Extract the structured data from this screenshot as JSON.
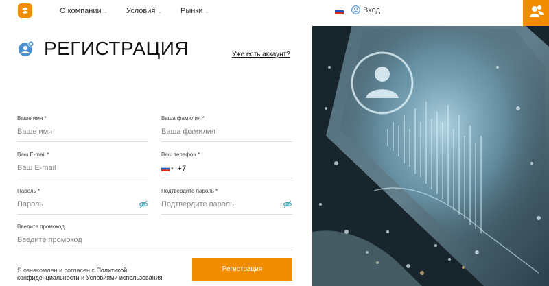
{
  "header": {
    "nav": [
      {
        "label": "О компании"
      },
      {
        "label": "Условия"
      },
      {
        "label": "Рынки"
      }
    ],
    "login_label": "Вход",
    "language": "ru"
  },
  "page": {
    "title": "РЕГИСТРАЦИЯ",
    "has_account_link": "Уже есть аккаунт?"
  },
  "form": {
    "first_name": {
      "label": "Ваше имя *",
      "placeholder": "Ваше имя"
    },
    "last_name": {
      "label": "Ваша фамилия *",
      "placeholder": "Ваша фамилия"
    },
    "email": {
      "label": "Ваш E-mail *",
      "placeholder": "Ваш E-mail"
    },
    "phone": {
      "label": "Ваш телефон *",
      "value": "+7"
    },
    "password": {
      "label": "Пароль *",
      "placeholder": "Пароль"
    },
    "password_confirm": {
      "label": "Подтвердите пароль *",
      "placeholder": "Подтвердите пароль"
    },
    "promo": {
      "label": "Введите промокод",
      "placeholder": "Введите промокод"
    },
    "agree_text": "Я ознакомлен и согласен с",
    "privacy_link": "Политикой конфиденциальности",
    "and_text": "и",
    "terms_link": "Условиями использования",
    "submit_label": "Регистрация"
  },
  "colors": {
    "accent": "#f28c00",
    "icon_blue": "#4a8fcf",
    "eye_green": "#3aa6b9"
  }
}
